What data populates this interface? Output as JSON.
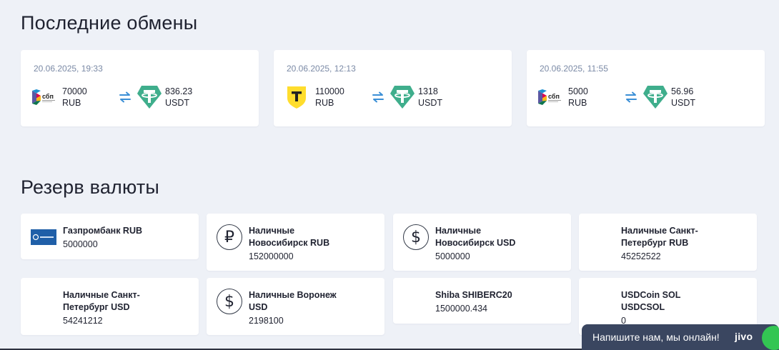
{
  "exchanges": {
    "title": "Последние обмены",
    "items": [
      {
        "date": "20.06.2025, 19:33",
        "from_icon": "sbp-icon",
        "from_amount": "70000",
        "from_currency": "RUB",
        "to_icon": "tether-icon",
        "to_amount": "836.23",
        "to_currency": "USDT"
      },
      {
        "date": "20.06.2025, 12:13",
        "from_icon": "tbank-icon",
        "from_amount": "110000",
        "from_currency": "RUB",
        "to_icon": "tether-icon",
        "to_amount": "1318",
        "to_currency": "USDT"
      },
      {
        "date": "20.06.2025, 11:55",
        "from_icon": "sbp-icon",
        "from_amount": "5000",
        "from_currency": "RUB",
        "to_icon": "tether-icon",
        "to_amount": "56.96",
        "to_currency": "USDT"
      }
    ]
  },
  "reserve": {
    "title": "Резерв валюты",
    "items": [
      {
        "name": "Газпромбанк RUB",
        "amount": "5000000",
        "icon": "gazprombank-icon"
      },
      {
        "name": "Наличные Новосибирск RUB",
        "amount": "152000000",
        "icon": "ruble-icon"
      },
      {
        "name": "Наличные Новосибирск USD",
        "amount": "5000000",
        "icon": "dollar-icon"
      },
      {
        "name": "Наличные Санкт-Петербург RUB",
        "amount": "45252522",
        "icon": ""
      },
      {
        "name": "Наличные Санкт-Петербург USD",
        "amount": "54241212",
        "icon": ""
      },
      {
        "name": "Наличные Воронеж USD",
        "amount": "2198100",
        "icon": "dollar-icon"
      },
      {
        "name": "Shiba SHIBERC20",
        "amount": "1500000.434",
        "icon": ""
      },
      {
        "name": "USDCoin SOL USDCSOL",
        "amount": "0",
        "icon": ""
      }
    ]
  },
  "chat": {
    "text": "Напишите нам, мы онлайн!",
    "logo": "jivo"
  },
  "colors": {
    "background": "#eef1f7",
    "card": "#ffffff",
    "date": "#7b8aa6",
    "tether": "#3fae8c",
    "arrows": "#3b8fd6",
    "tbank": "#ffdd2d",
    "gazprombank": "#1f5fa8",
    "chat": "#3a4660"
  }
}
